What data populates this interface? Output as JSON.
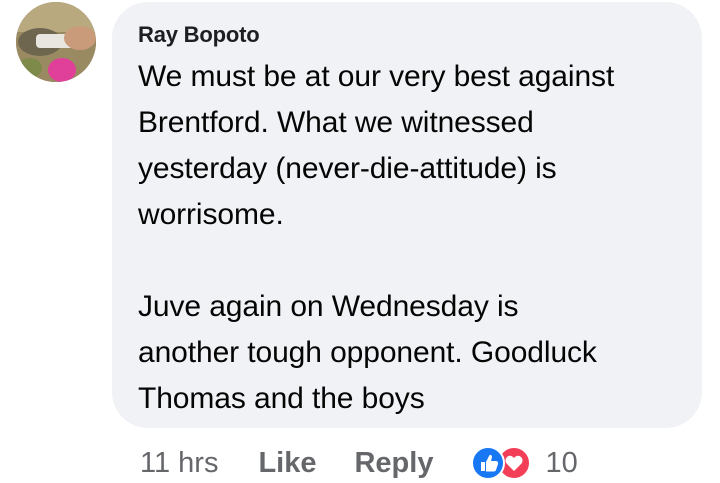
{
  "comment": {
    "author": "Ray Bopoto",
    "text": "We must be at our very best against\nBrentford. What we witnessed\nyesterday (never-die-attitude) is\nworrisome.\n\nJuve again on Wednesday is\nanother tough opponent.  Goodluck\nThomas and the boys"
  },
  "actions": {
    "time": "11 hrs",
    "like_label": "Like",
    "reply_label": "Reply",
    "reaction_count": "10"
  },
  "icons": {
    "reaction_1": "like-icon",
    "reaction_2": "love-icon",
    "like_color": "#1877f2",
    "love_color": "#f33e58"
  },
  "colors": {
    "bubble_bg": "#f0f2f5",
    "meta_text": "#65676b"
  }
}
